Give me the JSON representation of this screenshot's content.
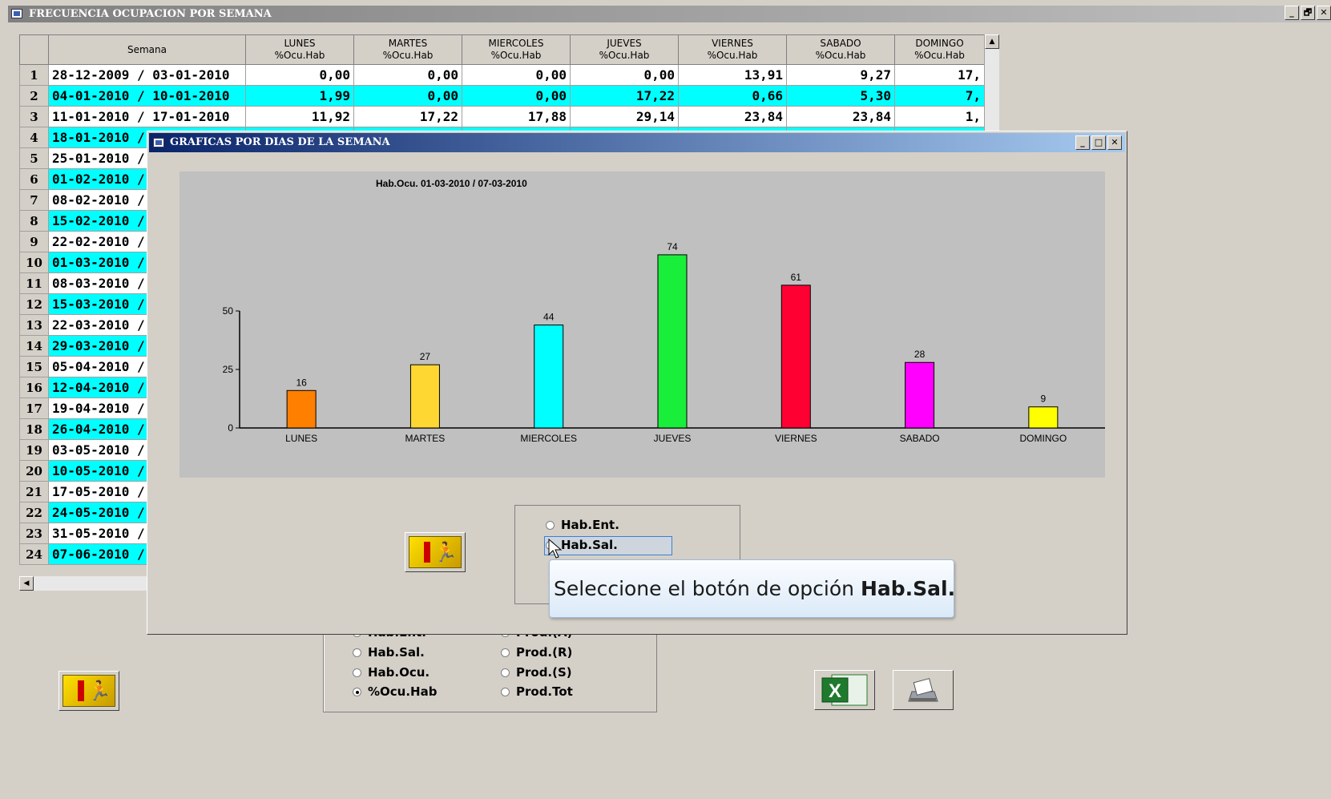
{
  "outer_window": {
    "title": "FRECUENCIA OCUPACION POR SEMANA",
    "controls": [
      "_",
      "🗗",
      "✕"
    ]
  },
  "table": {
    "headers": [
      {
        "line1": "",
        "line2": ""
      },
      {
        "line1": "Semana",
        "line2": ""
      },
      {
        "line1": "LUNES",
        "line2": "%Ocu.Hab"
      },
      {
        "line1": "MARTES",
        "line2": "%Ocu.Hab"
      },
      {
        "line1": "MIERCOLES",
        "line2": "%Ocu.Hab"
      },
      {
        "line1": "JUEVES",
        "line2": "%Ocu.Hab"
      },
      {
        "line1": "VIERNES",
        "line2": "%Ocu.Hab"
      },
      {
        "line1": "SABADO",
        "line2": "%Ocu.Hab"
      },
      {
        "line1": "DOMINGO",
        "line2": "%Ocu.Hab"
      }
    ],
    "rows": [
      {
        "n": "1",
        "semana": "28-12-2009 / 03-01-2010",
        "vals": [
          "0,00",
          "0,00",
          "0,00",
          "0,00",
          "13,91",
          "9,27",
          "17,"
        ]
      },
      {
        "n": "2",
        "semana": "04-01-2010 / 10-01-2010",
        "vals": [
          "1,99",
          "0,00",
          "0,00",
          "17,22",
          "0,66",
          "5,30",
          "7,"
        ]
      },
      {
        "n": "3",
        "semana": "11-01-2010 / 17-01-2010",
        "vals": [
          "11,92",
          "17,22",
          "17,88",
          "29,14",
          "23,84",
          "23,84",
          "1,"
        ]
      },
      {
        "n": "4",
        "semana": "18-01-2010 /",
        "vals": []
      },
      {
        "n": "5",
        "semana": "25-01-2010 /",
        "vals": []
      },
      {
        "n": "6",
        "semana": "01-02-2010 /",
        "vals": []
      },
      {
        "n": "7",
        "semana": "08-02-2010 /",
        "vals": []
      },
      {
        "n": "8",
        "semana": "15-02-2010 /",
        "vals": []
      },
      {
        "n": "9",
        "semana": "22-02-2010 /",
        "vals": []
      },
      {
        "n": "10",
        "semana": "01-03-2010 /",
        "vals": []
      },
      {
        "n": "11",
        "semana": "08-03-2010 /",
        "vals": []
      },
      {
        "n": "12",
        "semana": "15-03-2010 /",
        "vals": []
      },
      {
        "n": "13",
        "semana": "22-03-2010 /",
        "vals": []
      },
      {
        "n": "14",
        "semana": "29-03-2010 /",
        "vals": []
      },
      {
        "n": "15",
        "semana": "05-04-2010 /",
        "vals": []
      },
      {
        "n": "16",
        "semana": "12-04-2010 /",
        "vals": []
      },
      {
        "n": "17",
        "semana": "19-04-2010 /",
        "vals": []
      },
      {
        "n": "18",
        "semana": "26-04-2010 /",
        "vals": []
      },
      {
        "n": "19",
        "semana": "03-05-2010 /",
        "vals": []
      },
      {
        "n": "20",
        "semana": "10-05-2010 /",
        "vals": []
      },
      {
        "n": "21",
        "semana": "17-05-2010 /",
        "vals": []
      },
      {
        "n": "22",
        "semana": "24-05-2010 /",
        "vals": []
      },
      {
        "n": "23",
        "semana": "31-05-2010 /",
        "vals": []
      },
      {
        "n": "24",
        "semana": "07-06-2010 /",
        "vals": []
      }
    ],
    "row_colors": {
      "odd": "#ffffff",
      "even": "#00ffff"
    }
  },
  "outer_options": {
    "col1": [
      {
        "label": "Hab.Ent.",
        "selected": false
      },
      {
        "label": "Hab.Sal.",
        "selected": false
      },
      {
        "label": "Hab.Ocu.",
        "selected": false
      },
      {
        "label": "%Ocu.Hab",
        "selected": true
      }
    ],
    "col2": [
      {
        "label": "Prod.(A)",
        "selected": false
      },
      {
        "label": "Prod.(R)",
        "selected": false
      },
      {
        "label": "Prod.(S)",
        "selected": false
      },
      {
        "label": "Prod.Tot",
        "selected": false
      }
    ]
  },
  "buttons": {
    "exit_icon": "exit-door-running-man-icon",
    "excel_icon": "excel-icon",
    "print_icon": "printer-icon"
  },
  "inner_window": {
    "title": "GRAFICAS POR DIAS DE LA SEMANA",
    "controls": [
      "_",
      "□",
      "✕"
    ]
  },
  "chart_data": {
    "type": "bar",
    "title": "Hab.Ocu.    01-03-2010 / 07-03-2010",
    "categories": [
      "LUNES",
      "MARTES",
      "MIERCOLES",
      "JUEVES",
      "VIERNES",
      "SABADO",
      "DOMINGO"
    ],
    "values": [
      16,
      27,
      44,
      74,
      61,
      28,
      9
    ],
    "colors": [
      "#ff8000",
      "#ffd733",
      "#00ffff",
      "#19ee3b",
      "#ff0033",
      "#ff00ff",
      "#ffff00"
    ],
    "yticks": [
      0,
      25,
      50
    ],
    "ylim": [
      0,
      80
    ],
    "grid": false,
    "legend": "none",
    "data_labels": true
  },
  "inner_options": [
    {
      "label": "Hab.Ent.",
      "selected": false
    },
    {
      "label": "Hab.Sal.",
      "selected": false,
      "focused": true
    }
  ],
  "tooltip": {
    "prefix": "Seleccione el botón de opción ",
    "target": "Hab.Sal."
  }
}
